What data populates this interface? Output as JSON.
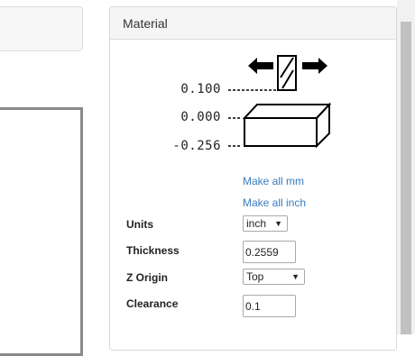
{
  "panel": {
    "title": "Material"
  },
  "diagram": {
    "dim_top": "0.100",
    "dim_mid": "0.000",
    "dim_bottom": "-0.256"
  },
  "links": {
    "make_mm": "Make all mm",
    "make_inch": "Make all inch"
  },
  "fields": {
    "units": {
      "label": "Units",
      "value": "inch"
    },
    "thickness": {
      "label": "Thickness",
      "value": "0.2559"
    },
    "z_origin": {
      "label": "Z Origin",
      "value": "Top"
    },
    "clearance": {
      "label": "Clearance",
      "value": "0.1"
    }
  },
  "icons": {
    "caret": "▼"
  }
}
